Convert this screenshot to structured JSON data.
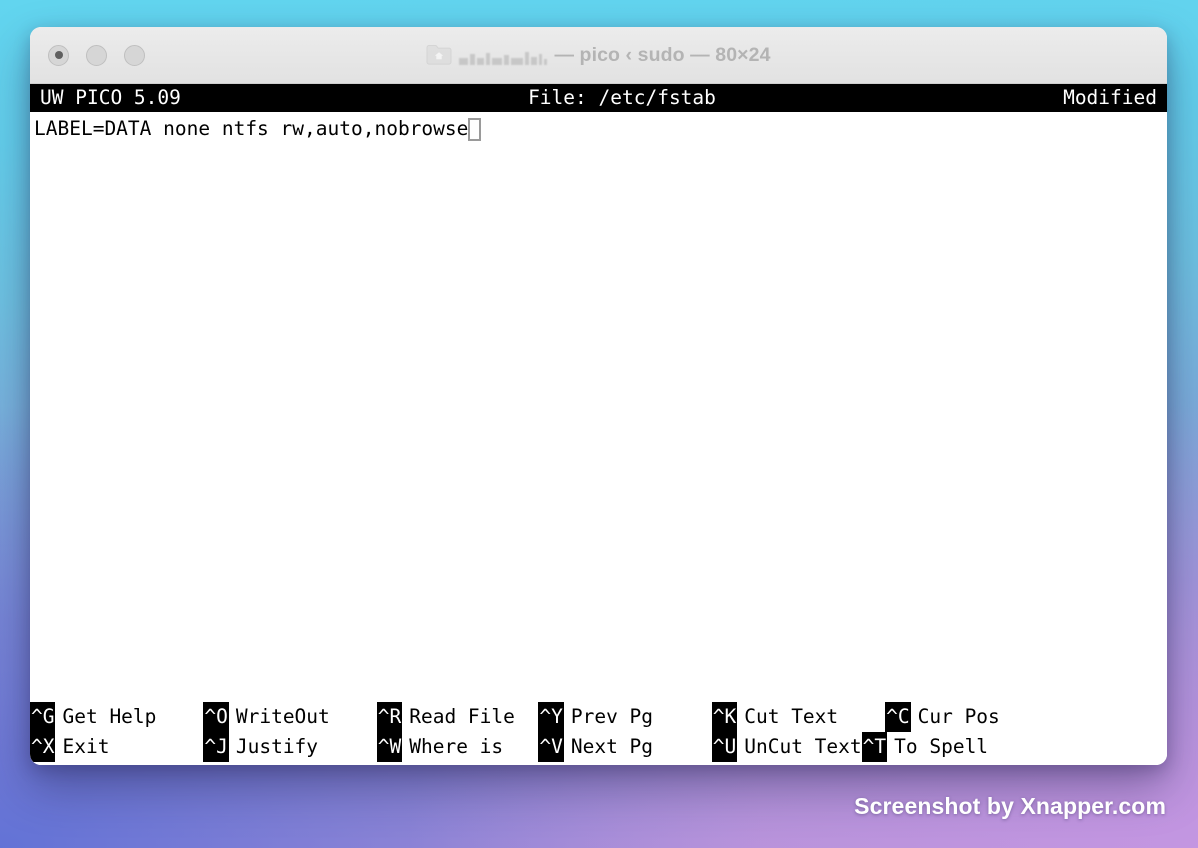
{
  "window": {
    "title": "— pico ‹ sudo — 80×24",
    "title_icon": "folder-icon",
    "redacted_label": "(blurred path)",
    "traffic_lights": [
      {
        "name": "close-button",
        "label": "close"
      },
      {
        "name": "minimize-button",
        "label": "minimize"
      },
      {
        "name": "zoom-button",
        "label": "zoom"
      }
    ]
  },
  "pico": {
    "version": "UW PICO 5.09",
    "file_label": "File: /etc/fstab",
    "status": "Modified",
    "content_line": "LABEL=DATA none ntfs rw,auto,nobrowse",
    "shortcuts_row1": [
      {
        "key": "^G",
        "label": "Get Help",
        "pad": 4
      },
      {
        "key": "^O",
        "label": "WriteOut",
        "pad": 4
      },
      {
        "key": "^R",
        "label": "Read File",
        "pad": 2
      },
      {
        "key": "^Y",
        "label": "Prev Pg",
        "pad": 5
      },
      {
        "key": "^K",
        "label": "Cut Text",
        "pad": 4
      },
      {
        "key": "^C",
        "label": "Cur Pos",
        "pad": 0
      }
    ],
    "shortcuts_row2": [
      {
        "key": "^X",
        "label": "Exit",
        "pad": 8
      },
      {
        "key": "^J",
        "label": "Justify",
        "pad": 5
      },
      {
        "key": "^W",
        "label": "Where is",
        "pad": 3
      },
      {
        "key": "^V",
        "label": "Next Pg",
        "pad": 5
      },
      {
        "key": "^U",
        "label": "UnCut Text",
        "pad": 0
      },
      {
        "key": "^T",
        "label": "To Spell",
        "pad": 0
      }
    ]
  },
  "watermark": {
    "text": "Screenshot by Xnapper.com"
  },
  "colors": {
    "terminal_bg": "#ffffff",
    "terminal_fg": "#000000",
    "header_bg": "#000000",
    "header_fg": "#ffffff",
    "cursor_outline": "#9a9a9a",
    "titlebar_bg": "#e8e8e8",
    "title_fg": "#b4b4b4",
    "backdrop_top": "#62d5ef",
    "backdrop_bottom_left": "#5c70d6",
    "backdrop_bottom_right": "#b391d6"
  }
}
